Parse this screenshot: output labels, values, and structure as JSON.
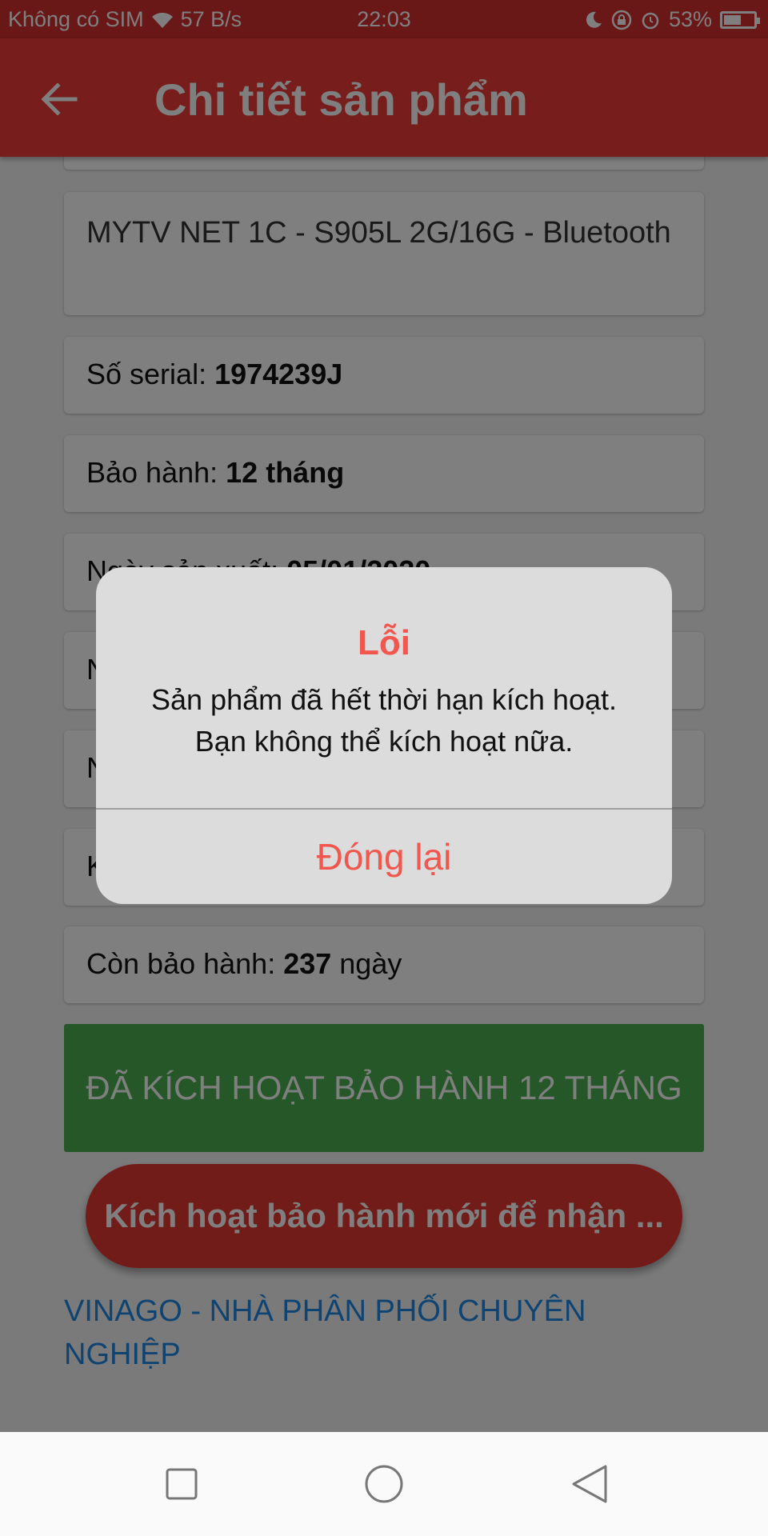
{
  "status_bar": {
    "carrier": "Không có SIM",
    "speed": "57 B/s",
    "time": "22:03",
    "battery": "53%",
    "battery_level": 0.53,
    "icons": [
      "wifi-icon",
      "moon-icon",
      "lock-rotation-icon",
      "alarm-icon",
      "battery-icon"
    ]
  },
  "app_bar": {
    "title": "Chi tiết sản phẩm",
    "back_icon": "back-arrow-icon"
  },
  "product": {
    "name": "MYTV NET 1C - S905L 2G/16G - Bluetooth",
    "serial_label": "Số serial: ",
    "serial_value": "1974239J",
    "warranty_label": "Bảo hành: ",
    "warranty_value": "12 tháng",
    "mfg_date_label": "Ngày sản xuất: ",
    "mfg_date_value": "05/01/2020",
    "hidden_row_1_initial": "N",
    "hidden_row_2_initial": "N",
    "hidden_row_3_initial": "K",
    "remaining_label": "Còn bảo hành: ",
    "remaining_value": "237",
    "remaining_unit": " ngày"
  },
  "activated_text": "ĐÃ KÍCH HOẠT BẢO HÀNH 12 THÁNG",
  "activate_button": "Kích hoạt bảo hành mới để nhận ...",
  "vinago_link": "VINAGO - NHÀ PHÂN PHỐI CHUYÊN NGHIỆP",
  "dialog": {
    "title": "Lỗi",
    "message": "Sản phẩm đã hết thời hạn kích hoạt. Bạn không thể kích hoạt nữa.",
    "close_label": "Đóng lại"
  },
  "colors": {
    "status_bar": "#d32f2f",
    "app_bar": "#ee3b36",
    "activated": "#4caf50",
    "activate_button": "#e53935",
    "link": "#1e88e5",
    "dialog_accent": "#f2564c"
  },
  "nav_bar": {
    "icons": [
      "recent-apps-icon",
      "home-icon",
      "back-triangle-icon"
    ]
  }
}
